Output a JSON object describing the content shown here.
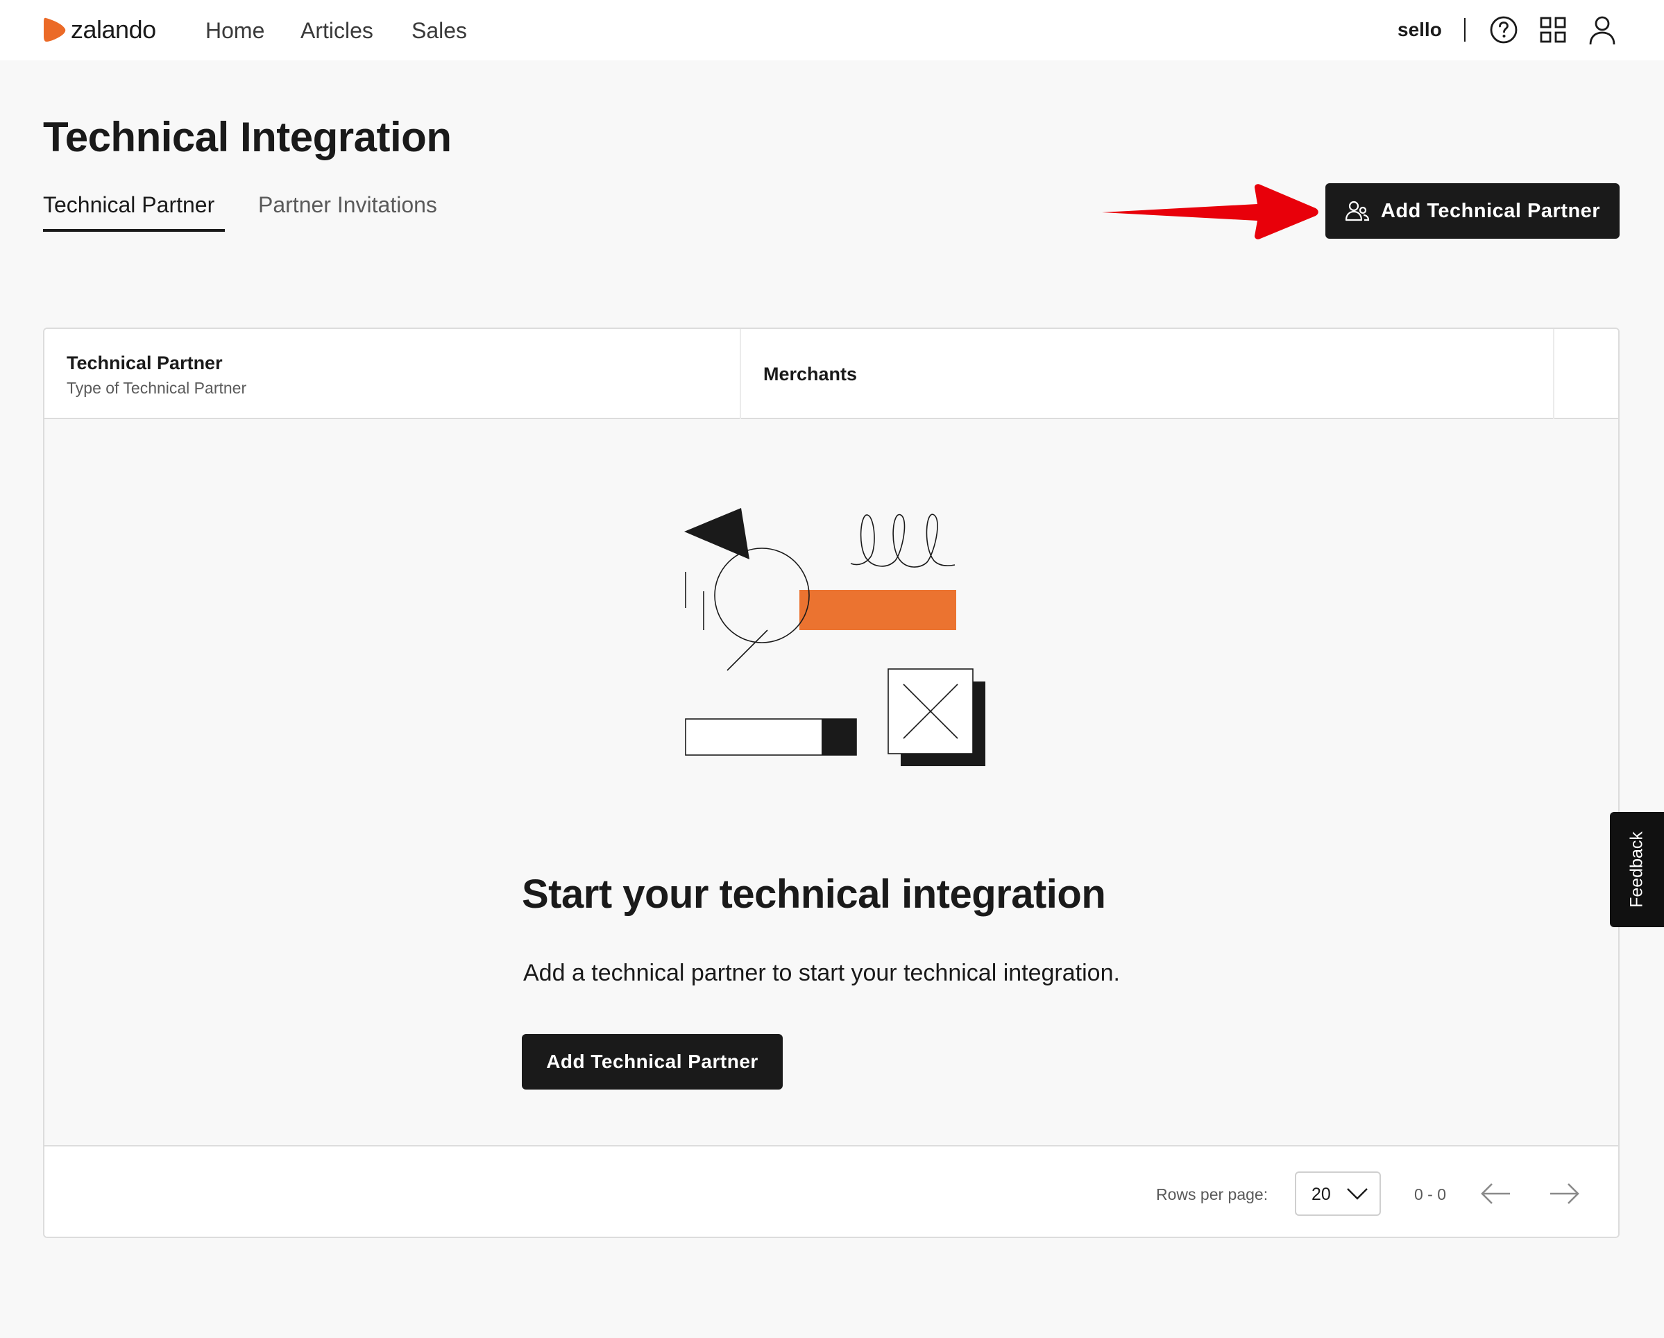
{
  "app": {
    "brand": "zalando",
    "brand_color": "#eb6a27"
  },
  "nav": {
    "links": [
      {
        "label": "Home"
      },
      {
        "label": "Articles"
      },
      {
        "label": "Sales"
      }
    ],
    "user_name": "sello",
    "icons": [
      "help-icon",
      "apps-grid-icon",
      "user-profile-icon"
    ]
  },
  "page": {
    "title": "Technical Integration",
    "tabs": [
      {
        "label": "Technical Partner",
        "active": true
      },
      {
        "label": "Partner Invitations",
        "active": false
      }
    ],
    "primary_button": {
      "label": "Add Technical Partner",
      "icon": "users-icon"
    }
  },
  "annotation": {
    "type": "red-arrow",
    "color": "#e8000a",
    "points_to": "Add Technical Partner"
  },
  "table": {
    "columns": [
      {
        "title": "Technical Partner",
        "subtitle": "Type of Technical Partner"
      },
      {
        "title": "Merchants",
        "subtitle": ""
      }
    ],
    "rows": [],
    "empty_state": {
      "title": "Start your technical integration",
      "description": "Add a technical partner to start your technical integration.",
      "button_label": "Add Technical Partner",
      "illustration_accent": "#eb7330"
    },
    "footer": {
      "rows_per_page_label": "Rows per page:",
      "rows_per_page_value": "20",
      "range_text": "0 - 0"
    }
  },
  "feedback_tab": {
    "label": "Feedback"
  }
}
